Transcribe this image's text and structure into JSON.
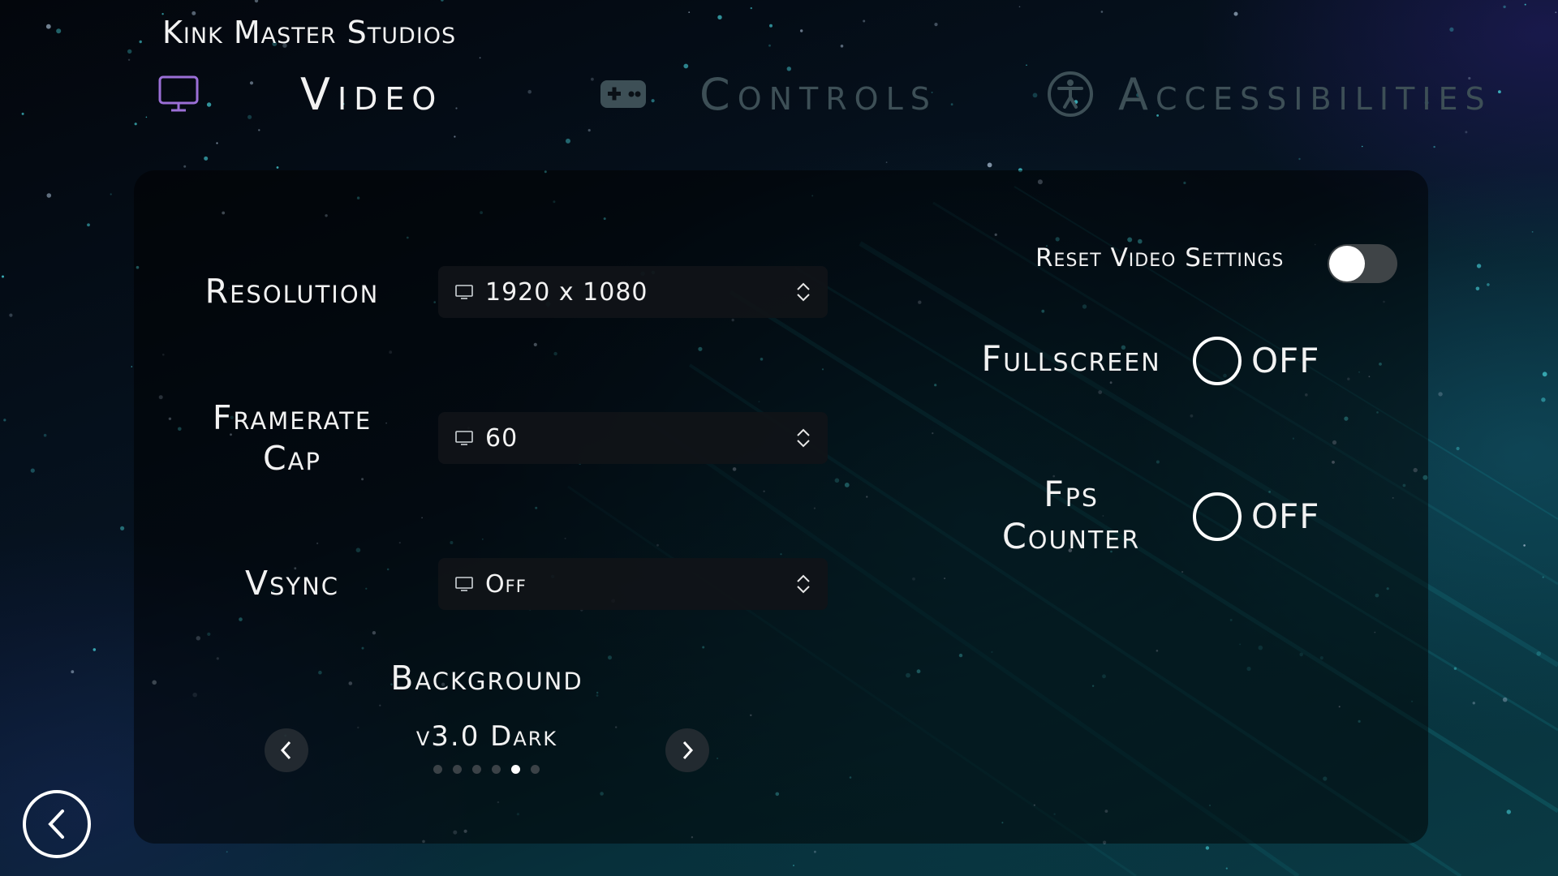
{
  "app": {
    "studio_name": "Kink Master Studios"
  },
  "tabs": [
    {
      "id": "video",
      "label": "Video",
      "icon": "monitor-icon",
      "active": true,
      "icon_color": "#9b6fd6"
    },
    {
      "id": "controls",
      "label": "Controls",
      "icon": "gamepad-icon",
      "active": false
    },
    {
      "id": "accessibilities",
      "label": "Accessibilities",
      "icon": "accessibility-icon",
      "active": false
    }
  ],
  "video": {
    "resolution": {
      "label": "Resolution",
      "value": "1920 x 1080",
      "icon": "monitor-icon"
    },
    "framerate": {
      "label_line1": "Framerate",
      "label_line2": "Cap",
      "value": "60",
      "icon": "monitor-icon"
    },
    "vsync": {
      "label": "Vsync",
      "value": "Off",
      "icon": "monitor-icon"
    },
    "background": {
      "label": "Background",
      "value": "v3.0 Dark",
      "page_count": 6,
      "current_page": 5
    },
    "reset": {
      "label": "Reset Video Settings",
      "enabled": false
    },
    "fullscreen": {
      "label": "Fullscreen",
      "state_text": "OFF",
      "checked": false
    },
    "fps_counter": {
      "label_line1": "Fps",
      "label_line2": "Counter",
      "state_text": "OFF",
      "checked": false
    }
  },
  "colors": {
    "inactive_tab": "#3d4f56",
    "accent": "#9b6fd6",
    "text": "#f2f2f2"
  }
}
